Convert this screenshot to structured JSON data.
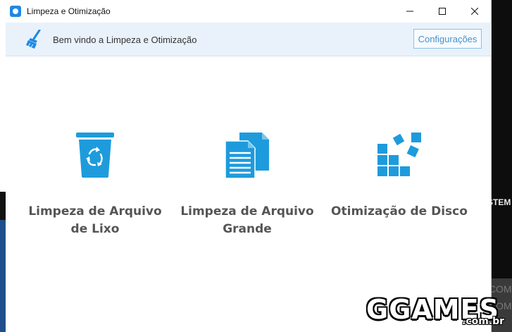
{
  "window": {
    "title": "Limpeza e Otimização"
  },
  "banner": {
    "welcome_text": "Bem vindo a Limpeza e Otimização",
    "settings_label": "Configurações"
  },
  "tools": [
    {
      "line1": "Limpeza de Arquivo",
      "line2": "de Lixo",
      "icon": "recycle-bin-icon"
    },
    {
      "line1": "Limpeza de Arquivo",
      "line2": "Grande",
      "icon": "documents-icon"
    },
    {
      "line1": "Otimização de Disco",
      "line2": "",
      "icon": "disk-blocks-icon"
    }
  ],
  "background": {
    "right_text": "STEM",
    "com_1": ".COM.BR",
    "com_2": ".COM.BR"
  },
  "watermark": {
    "text": "GGAMES",
    "suffix": ".com.br",
    "ghost": "GGAMES"
  },
  "colors": {
    "accent": "#1e9bdc",
    "banner_bg": "#e9f2fb",
    "label_text": "#555555"
  }
}
